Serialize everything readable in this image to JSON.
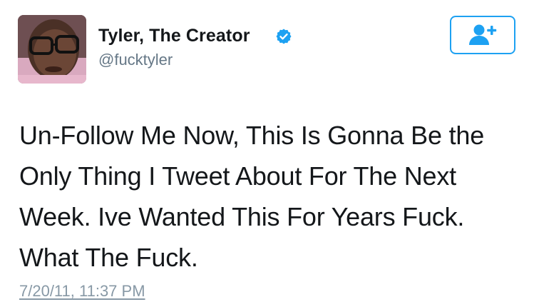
{
  "author": {
    "display_name": "Tyler, The Creator",
    "handle": "@fucktyler",
    "verified": true,
    "avatar_icon": "profile-photo"
  },
  "follow_button": {
    "icon": "add-user-icon",
    "color": "#1da1f2"
  },
  "tweet": {
    "lines": [
      "Un-Follow Me Now, This Is Gonna Be the",
      "Only Thing I Tweet About For The Next",
      "Week. Ive Wanted This For Years Fuck.",
      "What The Fuck."
    ],
    "timestamp": "7/20/11, 11:37 PM"
  },
  "colors": {
    "accent": "#1da1f2",
    "name": "#14171a",
    "muted": "#657786",
    "timestamp": "#8899a6"
  }
}
